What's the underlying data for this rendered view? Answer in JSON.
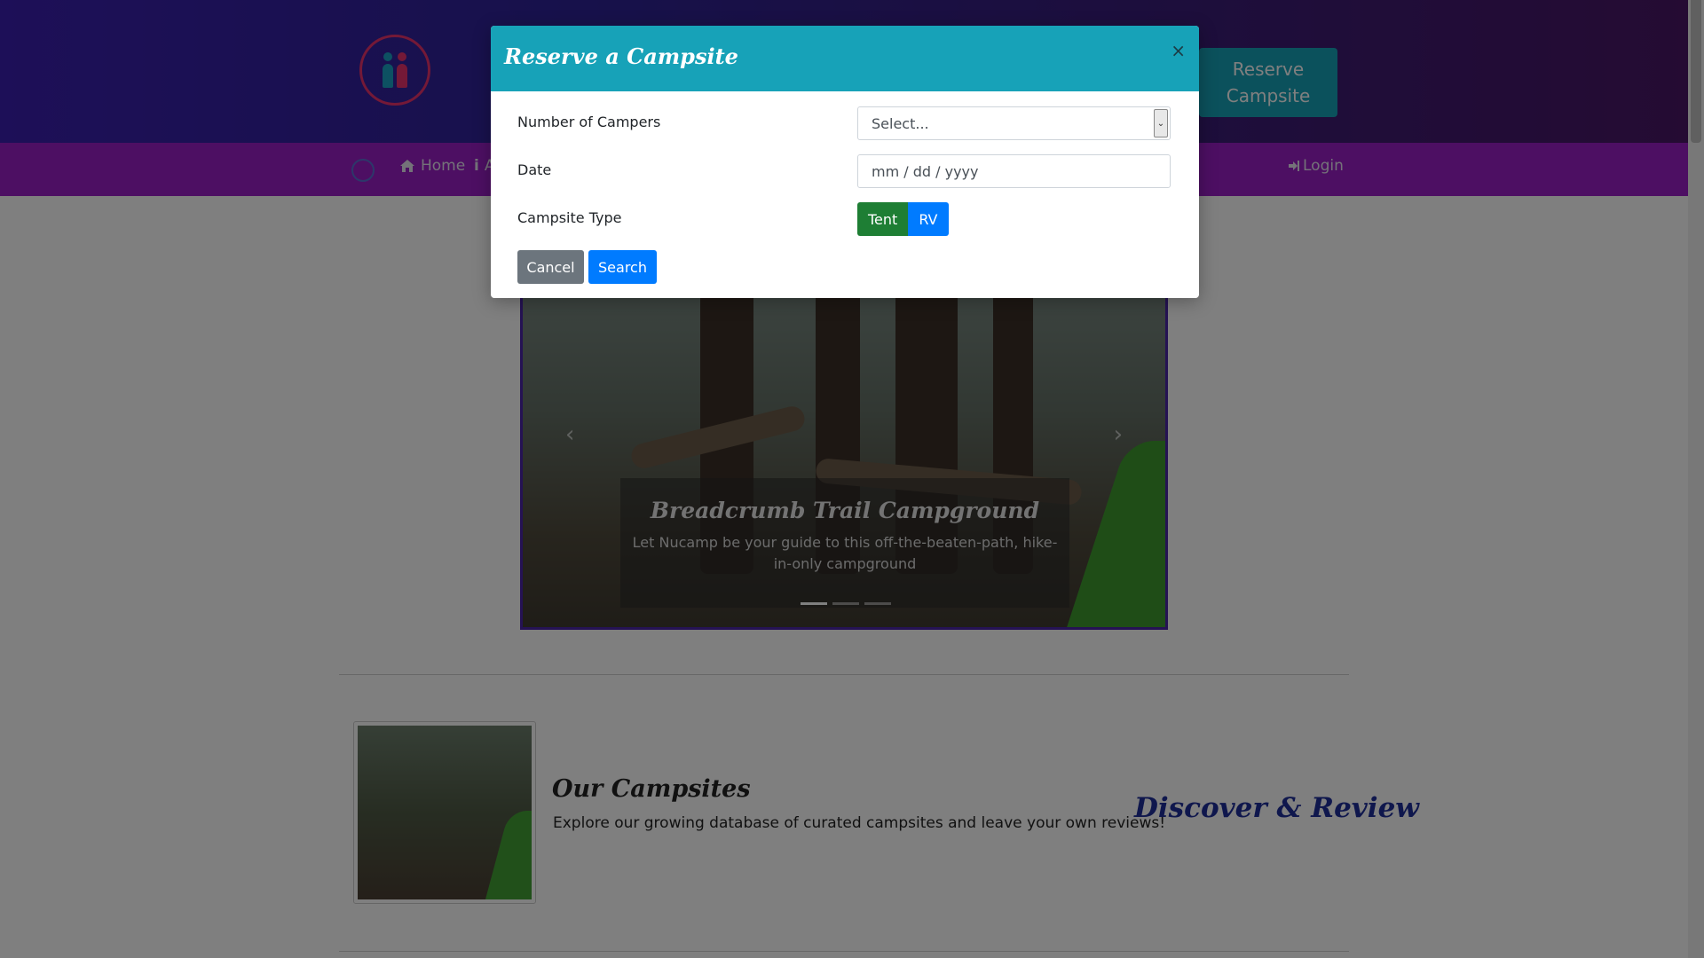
{
  "header": {
    "reserve_button_line1": "Reserve",
    "reserve_button_line2": "Campsite"
  },
  "nav": {
    "home_label": "Home",
    "about_label": "A",
    "login_label": "Login"
  },
  "carousel": {
    "title": "Breadcrumb Trail Campground",
    "text": "Let Nucamp be your guide to this off-the-beaten-path, hike-in-only campground",
    "prev_icon": "‹",
    "next_icon": "›"
  },
  "media": {
    "title": "Our Campsites",
    "text": "Explore our growing database of curated campsites and leave your own reviews!",
    "side_heading": "Discover & Review"
  },
  "modal": {
    "title": "Reserve a Campsite",
    "close_icon": "×",
    "campers_label": "Number of Campers",
    "campers_value": "Select...",
    "date_label": "Date",
    "date_placeholder": "mm / dd / yyyy",
    "type_label": "Campsite Type",
    "type_tent": "Tent",
    "type_rv": "RV",
    "cancel_label": "Cancel",
    "search_label": "Search"
  },
  "colors": {
    "modal_header": "#17a2b8",
    "navbar": "#9b1fc7",
    "primary": "#007bff",
    "success": "#1e7e34",
    "secondary": "#6c757d"
  }
}
